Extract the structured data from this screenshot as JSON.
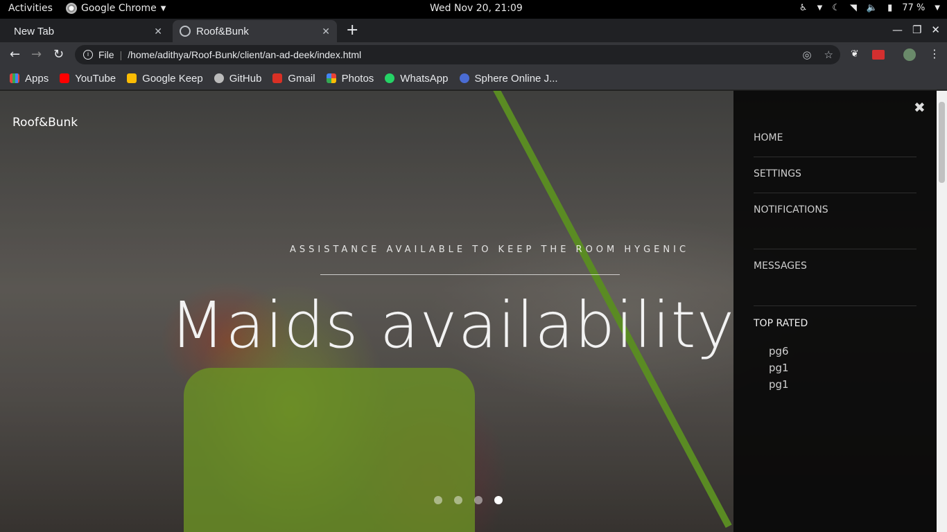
{
  "system": {
    "activities": "Activities",
    "app_name": "Google Chrome",
    "clock": "Wed Nov 20, 21:09",
    "battery": "77 %"
  },
  "tabs": [
    {
      "label": "New Tab"
    },
    {
      "label": "Roof&Bunk"
    }
  ],
  "address": {
    "scheme": "File",
    "url": "/home/adithya/Roof-Bunk/client/an-ad-deek/index.html"
  },
  "bookmarks": [
    {
      "label": "Apps",
      "color": "#e8453c"
    },
    {
      "label": "YouTube",
      "color": "#ff0000"
    },
    {
      "label": "Google Keep",
      "color": "#fbbc04"
    },
    {
      "label": "GitHub",
      "color": "#bbbbbb"
    },
    {
      "label": "Gmail",
      "color": "#d93025"
    },
    {
      "label": "Photos",
      "color": "#34a853"
    },
    {
      "label": "WhatsApp",
      "color": "#25d366"
    },
    {
      "label": "Sphere Online J...",
      "color": "#4a6cd4"
    }
  ],
  "hero": {
    "brand": "Roof&Bunk",
    "subtitle": "ASSISTANCE AVAILABLE TO KEEP THE ROOM HYGENIC",
    "headline": "Maids availability",
    "slides": 4,
    "active_slide": 4
  },
  "menu": {
    "items": [
      "HOME",
      "SETTINGS",
      "NOTIFICATIONS",
      "MESSAGES"
    ],
    "top_rated_label": "TOP RATED",
    "top_rated": [
      "pg6",
      "pg1",
      "pg1"
    ]
  }
}
